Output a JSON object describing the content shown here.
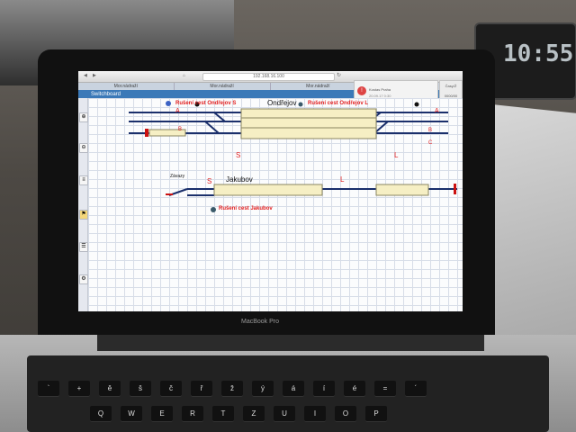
{
  "scene": {
    "clock_display": "10:55",
    "laptop_brand": "MacBook Pro"
  },
  "browser": {
    "address": "192.168.16.100",
    "tabs": [
      "Mor.nádraží",
      "Mor.nádraží",
      "Mor.nádraží",
      ""
    ]
  },
  "app": {
    "toolbar_title": "Switchboard",
    "notification": {
      "title": "Kostas Praha",
      "subtitle": "20.09.17 0:30"
    },
    "side_button": {
      "top": "Časy/Ž",
      "bottom": "0000/00"
    }
  },
  "stations": [
    {
      "name": "Ondřejov",
      "cancel_left": "Rušení cest Ondřejov S",
      "cancel_right": "Rušení cest Ondřejov L",
      "markers": {
        "a_left": "A",
        "a_right": "A",
        "b_left": "B",
        "b_right": "B",
        "c_right": "C",
        "s": "S",
        "l": "L"
      }
    },
    {
      "name": "Jakubov",
      "cancel": "Rušení cest Jakubov",
      "zavazy": "Závazy",
      "markers": {
        "s": "S",
        "l": "L"
      }
    }
  ],
  "keyboard": {
    "row1": [
      "`",
      "+",
      "ě",
      "š",
      "č",
      "ř",
      "ž",
      "ý",
      "á",
      "í",
      "é",
      "=",
      "´"
    ],
    "row2": [
      "Q",
      "W",
      "E",
      "R",
      "T",
      "Z",
      "U",
      "I",
      "O",
      "P"
    ]
  },
  "colors": {
    "track": "#1a2f6b",
    "platform": "#f6efc4",
    "accent_red": "#e21d1d",
    "toolbar_blue": "#3b79b8"
  }
}
